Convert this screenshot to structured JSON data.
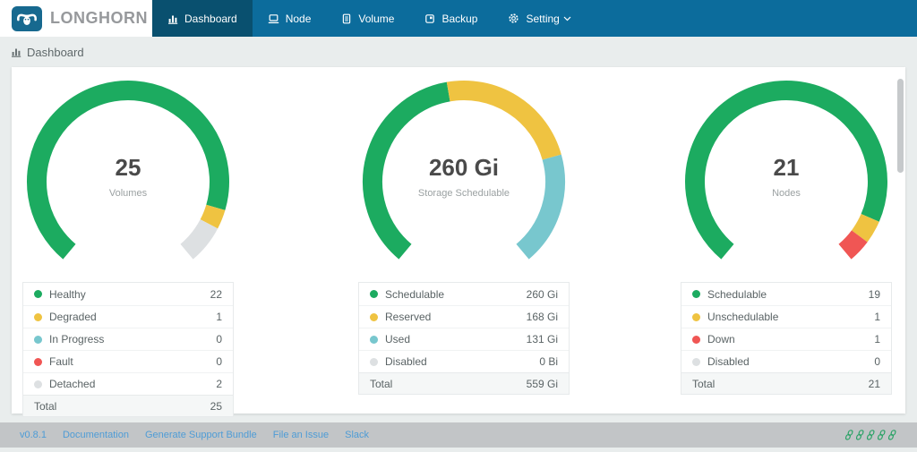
{
  "navbar": {
    "brand": "LONGHORN",
    "items": [
      {
        "label": "Dashboard",
        "active": true
      },
      {
        "label": "Node",
        "active": false
      },
      {
        "label": "Volume",
        "active": false
      },
      {
        "label": "Backup",
        "active": false
      },
      {
        "label": "Setting",
        "active": false,
        "has_caret": true
      }
    ]
  },
  "breadcrumb": {
    "label": "Dashboard"
  },
  "colors": {
    "navbar_bg": "#0c6c9c",
    "navbar_active_bg": "#09506f",
    "logo_blue": "#17698f",
    "page_bg": "#e9eded",
    "healthy_green": "#1cab60",
    "warning_yellow": "#efc341",
    "info_teal": "#78c7ce",
    "error_red": "#f05654",
    "neutral_gray": "#dde0e2",
    "footer_bg": "#c2c5c7",
    "link_blue": "#4e9cd6"
  },
  "chart_data": [
    {
      "type": "donut-gauge",
      "start_angle": 230,
      "sweep": 280,
      "center_value": "25",
      "center_label": "Volumes",
      "segments": [
        {
          "label": "Healthy",
          "value": 22,
          "display": "22",
          "color": "#1cab60"
        },
        {
          "label": "Degraded",
          "value": 1,
          "display": "1",
          "color": "#efc341"
        },
        {
          "label": "In Progress",
          "value": 0,
          "display": "0",
          "color": "#78c7ce"
        },
        {
          "label": "Fault",
          "value": 0,
          "display": "0",
          "color": "#f05654"
        },
        {
          "label": "Detached",
          "value": 2,
          "display": "2",
          "color": "#dde0e2"
        }
      ],
      "total_label": "Total",
      "total_display": "25"
    },
    {
      "type": "donut-gauge",
      "start_angle": 230,
      "sweep": 280,
      "center_value": "260 Gi",
      "center_label": "Storage Schedulable",
      "segments": [
        {
          "label": "Schedulable",
          "value": 260,
          "display": "260 Gi",
          "color": "#1cab60"
        },
        {
          "label": "Reserved",
          "value": 168,
          "display": "168 Gi",
          "color": "#efc341"
        },
        {
          "label": "Used",
          "value": 131,
          "display": "131 Gi",
          "color": "#78c7ce"
        },
        {
          "label": "Disabled",
          "value": 0,
          "display": "0 Bi",
          "color": "#dde0e2"
        }
      ],
      "total_label": "Total",
      "total_display": "559 Gi"
    },
    {
      "type": "donut-gauge",
      "start_angle": 230,
      "sweep": 280,
      "center_value": "21",
      "center_label": "Nodes",
      "segments": [
        {
          "label": "Schedulable",
          "value": 19,
          "display": "19",
          "color": "#1cab60"
        },
        {
          "label": "Unschedulable",
          "value": 1,
          "display": "1",
          "color": "#efc341"
        },
        {
          "label": "Down",
          "value": 1,
          "display": "1",
          "color": "#f05654"
        },
        {
          "label": "Disabled",
          "value": 0,
          "display": "0",
          "color": "#dde0e2"
        }
      ],
      "total_label": "Total",
      "total_display": "21"
    }
  ],
  "footer": {
    "version": "v0.8.1",
    "links": [
      "Documentation",
      "Generate Support Bundle",
      "File an Issue",
      "Slack"
    ],
    "status_icon_count": 5
  }
}
